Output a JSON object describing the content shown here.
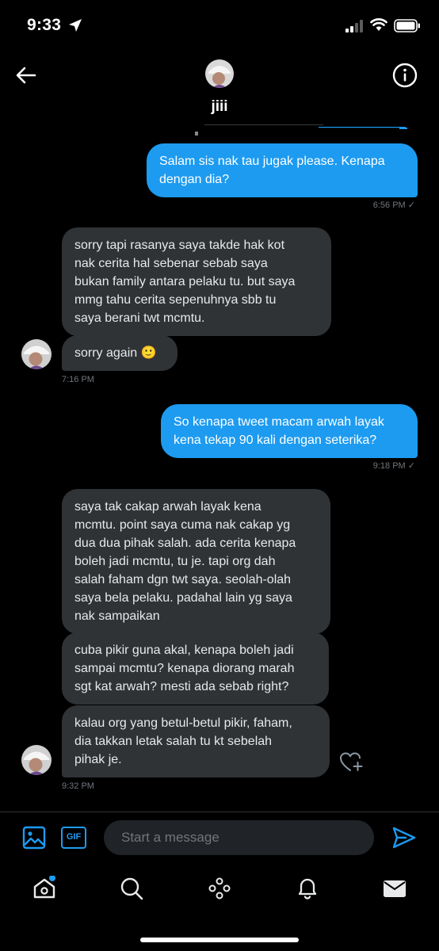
{
  "status": {
    "time": "9:33"
  },
  "header": {
    "name": "jiii"
  },
  "messages": [
    {
      "dir": "out",
      "text": "Salam sis nak tau jugak please. Kenapa\ndengan dia?",
      "time": "6:56 PM"
    },
    {
      "dir": "in",
      "text": "sorry tapi rasanya saya takde hak kot\nnak cerita hal sebenar sebab saya\nbukan family antara pelaku tu. but saya\nmmg tahu cerita sepenuhnya sbb tu\nsaya berani twt mcmtu."
    },
    {
      "dir": "in",
      "text": "sorry again 🙂",
      "time": "7:16 PM"
    },
    {
      "dir": "out",
      "text": "So kenapa tweet macam arwah layak\nkena tekap 90 kali dengan seterika?",
      "time": "9:18 PM"
    },
    {
      "dir": "in",
      "text": "saya tak cakap arwah layak kena\nmcmtu. point saya cuma nak cakap yg\ndua dua pihak salah. ada cerita kenapa\nboleh jadi mcmtu, tu je. tapi org dah\nsalah faham dgn twt saya. seolah-olah\nsaya bela pelaku. padahal lain yg saya\nnak sampaikan"
    },
    {
      "dir": "in",
      "text": "cuba pikir guna akal, kenapa boleh jadi\nsampai mcmtu? kenapa diorang marah\nsgt kat arwah? mesti ada sebab right?"
    },
    {
      "dir": "in",
      "text": "kalau org yang betul-betul pikir, faham,\ndia takkan letak salah tu kt sebelah\npihak je.",
      "time": "9:32 PM"
    }
  ],
  "composer": {
    "placeholder": "Start a message",
    "gif_label": "GIF"
  },
  "colors": {
    "accent": "#1d9bf0",
    "incoming_bubble": "#2f3336",
    "background": "#000000"
  },
  "icons": [
    "back-arrow-icon",
    "info-icon",
    "image-icon",
    "gif-icon",
    "send-icon",
    "heart-add-icon",
    "home-icon",
    "search-icon",
    "spaces-icon",
    "notifications-icon",
    "messages-icon"
  ]
}
